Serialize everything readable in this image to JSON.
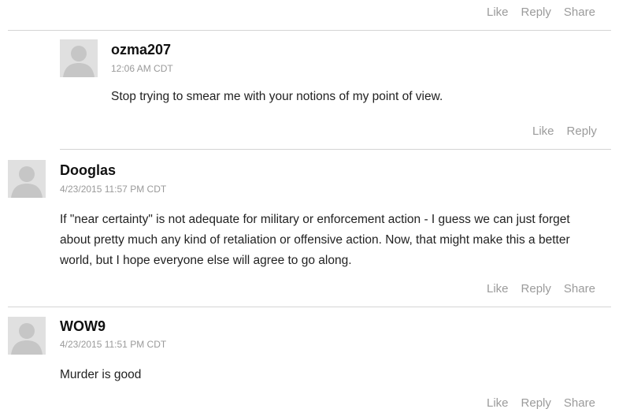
{
  "top_actions": {
    "like": "Like",
    "reply": "Reply",
    "share": "Share"
  },
  "comments": [
    {
      "author": "ozma207",
      "time": "12:06 AM CDT",
      "text": "Stop trying to smear me with your notions of my point of view.",
      "actions": {
        "like": "Like",
        "reply": "Reply"
      }
    },
    {
      "author": "Dooglas",
      "time": "4/23/2015 11:57 PM CDT",
      "text": "If \"near certainty\" is not adequate for military or enforcement action - I guess we can just forget about pretty much any kind of retaliation or offensive action. Now, that might make this a better world, but I hope everyone else will agree to go along.",
      "actions": {
        "like": "Like",
        "reply": "Reply",
        "share": "Share"
      }
    },
    {
      "author": "WOW9",
      "time": "4/23/2015 11:51 PM CDT",
      "text": "Murder is good",
      "actions": {
        "like": "Like",
        "reply": "Reply",
        "share": "Share"
      }
    }
  ],
  "icons": {
    "avatar": "default-avatar-icon"
  },
  "colors": {
    "action_text": "#9b9b9b",
    "divider": "#d4d4d4",
    "avatar_bg": "#e0e0e0",
    "avatar_fg": "#c8c8c8"
  }
}
